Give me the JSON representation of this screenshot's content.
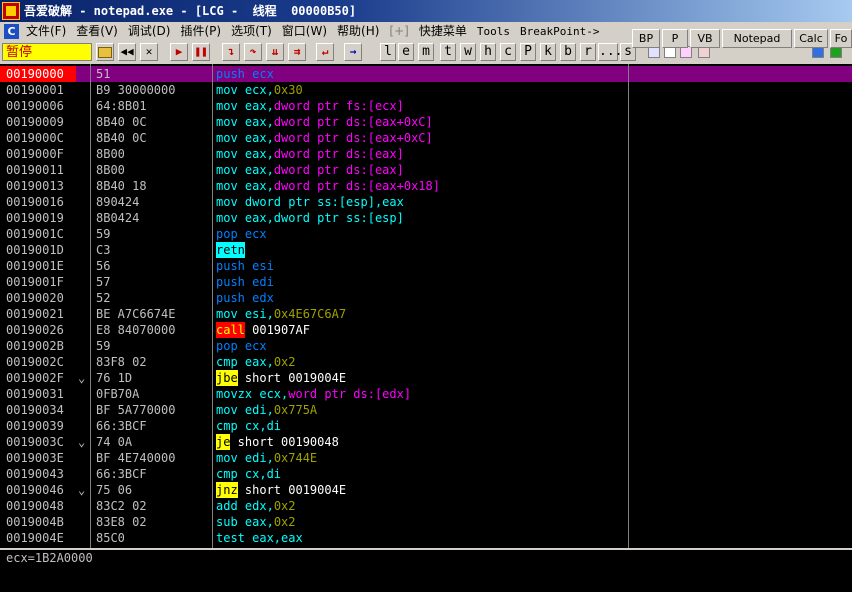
{
  "window": {
    "title": "吾爱破解 - notepad.exe - [LCG -  线程  00000B50]"
  },
  "menu": {
    "items": [
      {
        "label": "文件(F)",
        "dim": false
      },
      {
        "label": "查看(V)",
        "dim": false
      },
      {
        "label": "调试(D)",
        "dim": false
      },
      {
        "label": "插件(P)",
        "dim": false
      },
      {
        "label": "选项(T)",
        "dim": false
      },
      {
        "label": "窗口(W)",
        "dim": false
      },
      {
        "label": "帮助(H)",
        "dim": false
      },
      {
        "label": "[+]",
        "dim": true
      },
      {
        "label": "快捷菜单",
        "dim": false
      },
      {
        "label": "Tools",
        "dim": false,
        "mono": true
      },
      {
        "label": "BreakPoint->",
        "dim": false,
        "mono": true
      }
    ]
  },
  "toolbar": {
    "status": "暂停",
    "letters": [
      "l",
      "e",
      "m",
      "t",
      "w",
      "h",
      "c",
      "P",
      "k",
      "b",
      "r",
      "...",
      "s"
    ],
    "plugin_buttons": [
      "BP",
      "P",
      "VB",
      "Notepad",
      "Calc",
      "Fo"
    ]
  },
  "colors": {
    "mnemonic": "#00ffff",
    "jump": "#ffff00",
    "operand_white": "#ffffff",
    "ptr": "#ff00ff",
    "immediate": "#a0a000",
    "stack_op": "#0080ff",
    "call_label": "#ffffff"
  },
  "disasm": [
    {
      "addr": "00190000",
      "mark": "",
      "hex": "51",
      "mn": "push",
      "mn_color": "blue",
      "parts": [
        {
          "t": " ecx",
          "c": "blue"
        }
      ],
      "selected": true
    },
    {
      "addr": "00190001",
      "mark": "",
      "hex": "B9 30000000",
      "mn": "mov",
      "mn_color": "cyan",
      "parts": [
        {
          "t": " ecx,",
          "c": "cyan"
        },
        {
          "t": "0x30",
          "c": "imm"
        }
      ]
    },
    {
      "addr": "00190006",
      "mark": "",
      "hex": "64:8B01",
      "mn": "mov",
      "mn_color": "cyan",
      "parts": [
        {
          "t": " eax,",
          "c": "cyan"
        },
        {
          "t": "dword ptr fs:[ecx]",
          "c": "ptr"
        }
      ]
    },
    {
      "addr": "00190009",
      "mark": "",
      "hex": "8B40 0C",
      "mn": "mov",
      "mn_color": "cyan",
      "parts": [
        {
          "t": " eax,",
          "c": "cyan"
        },
        {
          "t": "dword ptr ds:[eax+0xC]",
          "c": "ptr"
        }
      ]
    },
    {
      "addr": "0019000C",
      "mark": "",
      "hex": "8B40 0C",
      "mn": "mov",
      "mn_color": "cyan",
      "parts": [
        {
          "t": " eax,",
          "c": "cyan"
        },
        {
          "t": "dword ptr ds:[eax+0xC]",
          "c": "ptr"
        }
      ]
    },
    {
      "addr": "0019000F",
      "mark": "",
      "hex": "8B00",
      "mn": "mov",
      "mn_color": "cyan",
      "parts": [
        {
          "t": " eax,",
          "c": "cyan"
        },
        {
          "t": "dword ptr ds:[eax]",
          "c": "ptr"
        }
      ]
    },
    {
      "addr": "00190011",
      "mark": "",
      "hex": "8B00",
      "mn": "mov",
      "mn_color": "cyan",
      "parts": [
        {
          "t": " eax,",
          "c": "cyan"
        },
        {
          "t": "dword ptr ds:[eax]",
          "c": "ptr"
        }
      ]
    },
    {
      "addr": "00190013",
      "mark": "",
      "hex": "8B40 18",
      "mn": "mov",
      "mn_color": "cyan",
      "parts": [
        {
          "t": " eax,",
          "c": "cyan"
        },
        {
          "t": "dword ptr ds:[eax+0x18]",
          "c": "ptr"
        }
      ]
    },
    {
      "addr": "00190016",
      "mark": "",
      "hex": "890424",
      "mn": "mov",
      "mn_color": "cyan",
      "parts": [
        {
          "t": " dword ptr ss:[esp],eax",
          "c": "cyan"
        }
      ]
    },
    {
      "addr": "00190019",
      "mark": "",
      "hex": "8B0424",
      "mn": "mov",
      "mn_color": "cyan",
      "parts": [
        {
          "t": " eax,dword ptr ss:[esp]",
          "c": "cyan"
        }
      ]
    },
    {
      "addr": "0019001C",
      "mark": "",
      "hex": "59",
      "mn": "pop",
      "mn_color": "blue",
      "parts": [
        {
          "t": " ecx",
          "c": "blue"
        }
      ]
    },
    {
      "addr": "0019001D",
      "mark": "",
      "hex": "C3",
      "mn": "retn",
      "mn_color": "hl-cyan",
      "parts": []
    },
    {
      "addr": "0019001E",
      "mark": "",
      "hex": "56",
      "mn": "push",
      "mn_color": "blue",
      "parts": [
        {
          "t": " esi",
          "c": "blue"
        }
      ]
    },
    {
      "addr": "0019001F",
      "mark": "",
      "hex": "57",
      "mn": "push",
      "mn_color": "blue",
      "parts": [
        {
          "t": " edi",
          "c": "blue"
        }
      ]
    },
    {
      "addr": "00190020",
      "mark": "",
      "hex": "52",
      "mn": "push",
      "mn_color": "blue",
      "parts": [
        {
          "t": " edx",
          "c": "blue"
        }
      ]
    },
    {
      "addr": "00190021",
      "mark": "",
      "hex": "BE A7C6674E",
      "mn": "mov",
      "mn_color": "cyan",
      "parts": [
        {
          "t": " esi,",
          "c": "cyan"
        },
        {
          "t": "0x4E67C6A7",
          "c": "imm"
        }
      ]
    },
    {
      "addr": "00190026",
      "mark": "",
      "hex": "E8 84070000",
      "mn": "call",
      "mn_color": "hl-red",
      "parts": [
        {
          "t": " 001907AF",
          "c": "white"
        }
      ]
    },
    {
      "addr": "0019002B",
      "mark": "",
      "hex": "59",
      "mn": "pop",
      "mn_color": "blue",
      "parts": [
        {
          "t": " ecx",
          "c": "blue"
        }
      ]
    },
    {
      "addr": "0019002C",
      "mark": "",
      "hex": "83F8 02",
      "mn": "cmp",
      "mn_color": "cyan",
      "parts": [
        {
          "t": " eax,",
          "c": "cyan"
        },
        {
          "t": "0x2",
          "c": "imm"
        }
      ]
    },
    {
      "addr": "0019002F",
      "mark": "⌄",
      "hex": "76 1D",
      "mn": "jbe",
      "mn_color": "hl-yellow",
      "parts": [
        {
          "t": " short 0019004E",
          "c": "white"
        }
      ]
    },
    {
      "addr": "00190031",
      "mark": "",
      "hex": "0FB70A",
      "mn": "movzx",
      "mn_color": "cyan",
      "parts": [
        {
          "t": " ecx,",
          "c": "cyan"
        },
        {
          "t": "word ptr ds:[edx]",
          "c": "ptr"
        }
      ]
    },
    {
      "addr": "00190034",
      "mark": "",
      "hex": "BF 5A770000",
      "mn": "mov",
      "mn_color": "cyan",
      "parts": [
        {
          "t": " edi,",
          "c": "cyan"
        },
        {
          "t": "0x775A",
          "c": "imm"
        }
      ]
    },
    {
      "addr": "00190039",
      "mark": "",
      "hex": "66:3BCF",
      "mn": "cmp",
      "mn_color": "cyan",
      "parts": [
        {
          "t": " cx,di",
          "c": "cyan"
        }
      ]
    },
    {
      "addr": "0019003C",
      "mark": "⌄",
      "hex": "74 0A",
      "mn": "je",
      "mn_color": "hl-yellow",
      "parts": [
        {
          "t": " short 00190048",
          "c": "white"
        }
      ]
    },
    {
      "addr": "0019003E",
      "mark": "",
      "hex": "BF 4E740000",
      "mn": "mov",
      "mn_color": "cyan",
      "parts": [
        {
          "t": " edi,",
          "c": "cyan"
        },
        {
          "t": "0x744E",
          "c": "imm"
        }
      ]
    },
    {
      "addr": "00190043",
      "mark": "",
      "hex": "66:3BCF",
      "mn": "cmp",
      "mn_color": "cyan",
      "parts": [
        {
          "t": " cx,di",
          "c": "cyan"
        }
      ]
    },
    {
      "addr": "00190046",
      "mark": "⌄",
      "hex": "75 06",
      "mn": "jnz",
      "mn_color": "hl-yellow",
      "parts": [
        {
          "t": " short 0019004E",
          "c": "white"
        }
      ]
    },
    {
      "addr": "00190048",
      "mark": "",
      "hex": "83C2 02",
      "mn": "add",
      "mn_color": "cyan",
      "parts": [
        {
          "t": " edx,",
          "c": "cyan"
        },
        {
          "t": "0x2",
          "c": "imm"
        }
      ]
    },
    {
      "addr": "0019004B",
      "mark": "",
      "hex": "83E8 02",
      "mn": "sub",
      "mn_color": "cyan",
      "parts": [
        {
          "t": " eax,",
          "c": "cyan"
        },
        {
          "t": "0x2",
          "c": "imm"
        }
      ]
    },
    {
      "addr": "0019004E",
      "mark": "",
      "hex": "85C0",
      "mn": "test",
      "mn_color": "cyan",
      "parts": [
        {
          "t": " eax,eax",
          "c": "cyan"
        }
      ]
    }
  ],
  "info": {
    "text": "ecx=1B2A0000"
  }
}
